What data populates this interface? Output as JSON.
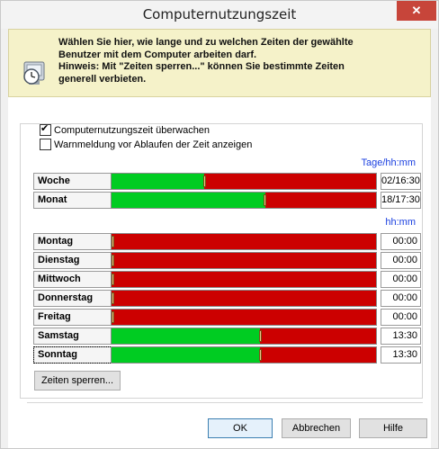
{
  "window": {
    "title": "Computernutzungszeit",
    "close_label": "✕"
  },
  "info": {
    "text": "Wählen Sie hier, wie lange und zu welchen Zeiten der gewählte\nBenutzer mit dem Computer  arbeiten darf.\nHinweis: Mit \"Zeiten sperren...\" können Sie bestimmte Zeiten\ngenerell verbieten."
  },
  "options": {
    "monitor_label": "Computernutzungszeit überwachen",
    "monitor_checked": true,
    "warning_label": "Warnmeldung vor Ablaufen der Zeit anzeigen",
    "warning_checked": false
  },
  "period": {
    "unit_label": "Tage/hh:mm",
    "rows": [
      {
        "label": "Woche",
        "value": "02/16:30",
        "allowed_fraction": 0.35
      },
      {
        "label": "Monat",
        "value": "18/17:30",
        "allowed_fraction": 0.58
      }
    ]
  },
  "daily": {
    "unit_label": "hh:mm",
    "rows": [
      {
        "label": "Montag",
        "value": "00:00",
        "allowed_fraction": 0.0
      },
      {
        "label": "Dienstag",
        "value": "00:00",
        "allowed_fraction": 0.0
      },
      {
        "label": "Mittwoch",
        "value": "00:00",
        "allowed_fraction": 0.0
      },
      {
        "label": "Donnerstag",
        "value": "00:00",
        "allowed_fraction": 0.0
      },
      {
        "label": "Freitag",
        "value": "00:00",
        "allowed_fraction": 0.0
      },
      {
        "label": "Samstag",
        "value": "13:30",
        "allowed_fraction": 0.5625
      },
      {
        "label": "Sonntag",
        "value": "13:30",
        "allowed_fraction": 0.5625
      }
    ]
  },
  "buttons": {
    "lock_times": "Zeiten sperren...",
    "ok": "OK",
    "cancel": "Abbrechen",
    "help": "Hilfe"
  },
  "colors": {
    "allowed": "#00cc22",
    "blocked": "#cc0000",
    "unit_text": "#1a3fe0"
  }
}
